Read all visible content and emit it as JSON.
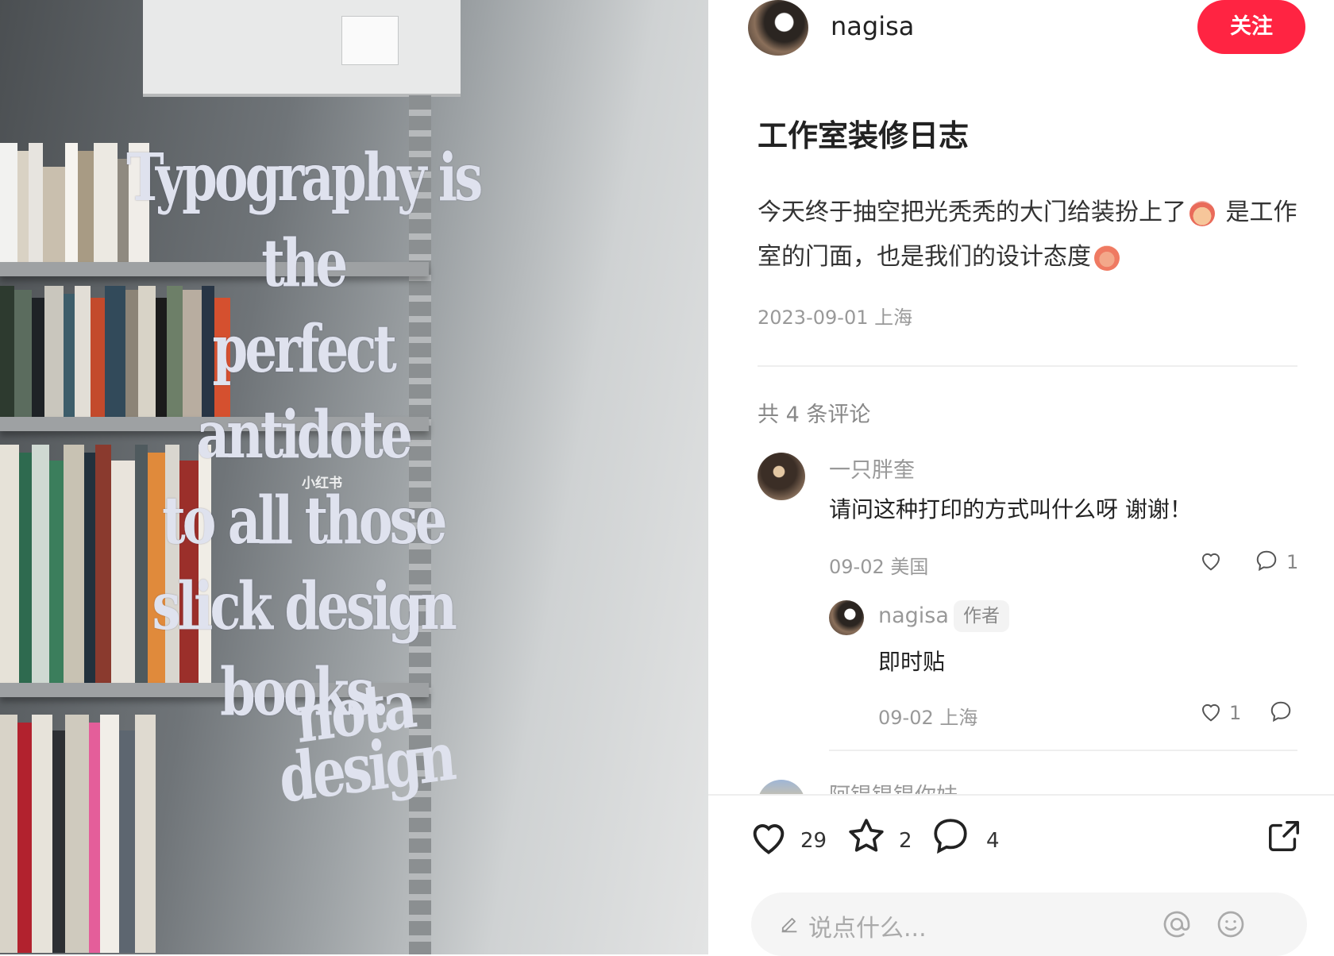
{
  "photo": {
    "quote_lines": [
      "Typography is the",
      "perfect antidote",
      "to all those",
      "slick design",
      "books."
    ],
    "brand_lines": [
      "nota",
      "design"
    ],
    "watermark": "小红书"
  },
  "header": {
    "author_name": "nagisa",
    "follow_label": "关注"
  },
  "post": {
    "title": "工作室装修日志",
    "body_part1": "今天终于抽空把光秃秃的大门给装扮上了",
    "body_part2": " 是工作室的门面，也是我们的设计态度",
    "meta": "2023-09-01 上海"
  },
  "comments": {
    "count_label": "共 4 条评论",
    "items": [
      {
        "name": "一只胖奎",
        "text": "请问这种打印的方式叫什么呀 谢谢！",
        "meta": "09-02 美国",
        "like_count": "",
        "reply_count": "1"
      }
    ],
    "reply": {
      "name": "nagisa",
      "tag": "作者",
      "text": "即时贴",
      "meta": "09-02 上海",
      "like_count": "1"
    },
    "partial_next_name": "阿锟锟锟你妹"
  },
  "actions": {
    "likes": "29",
    "favorites": "2",
    "comments": "4"
  },
  "input": {
    "placeholder": "说点什么..."
  },
  "colors": {
    "accent": "#ff2442",
    "muted": "#999999"
  }
}
